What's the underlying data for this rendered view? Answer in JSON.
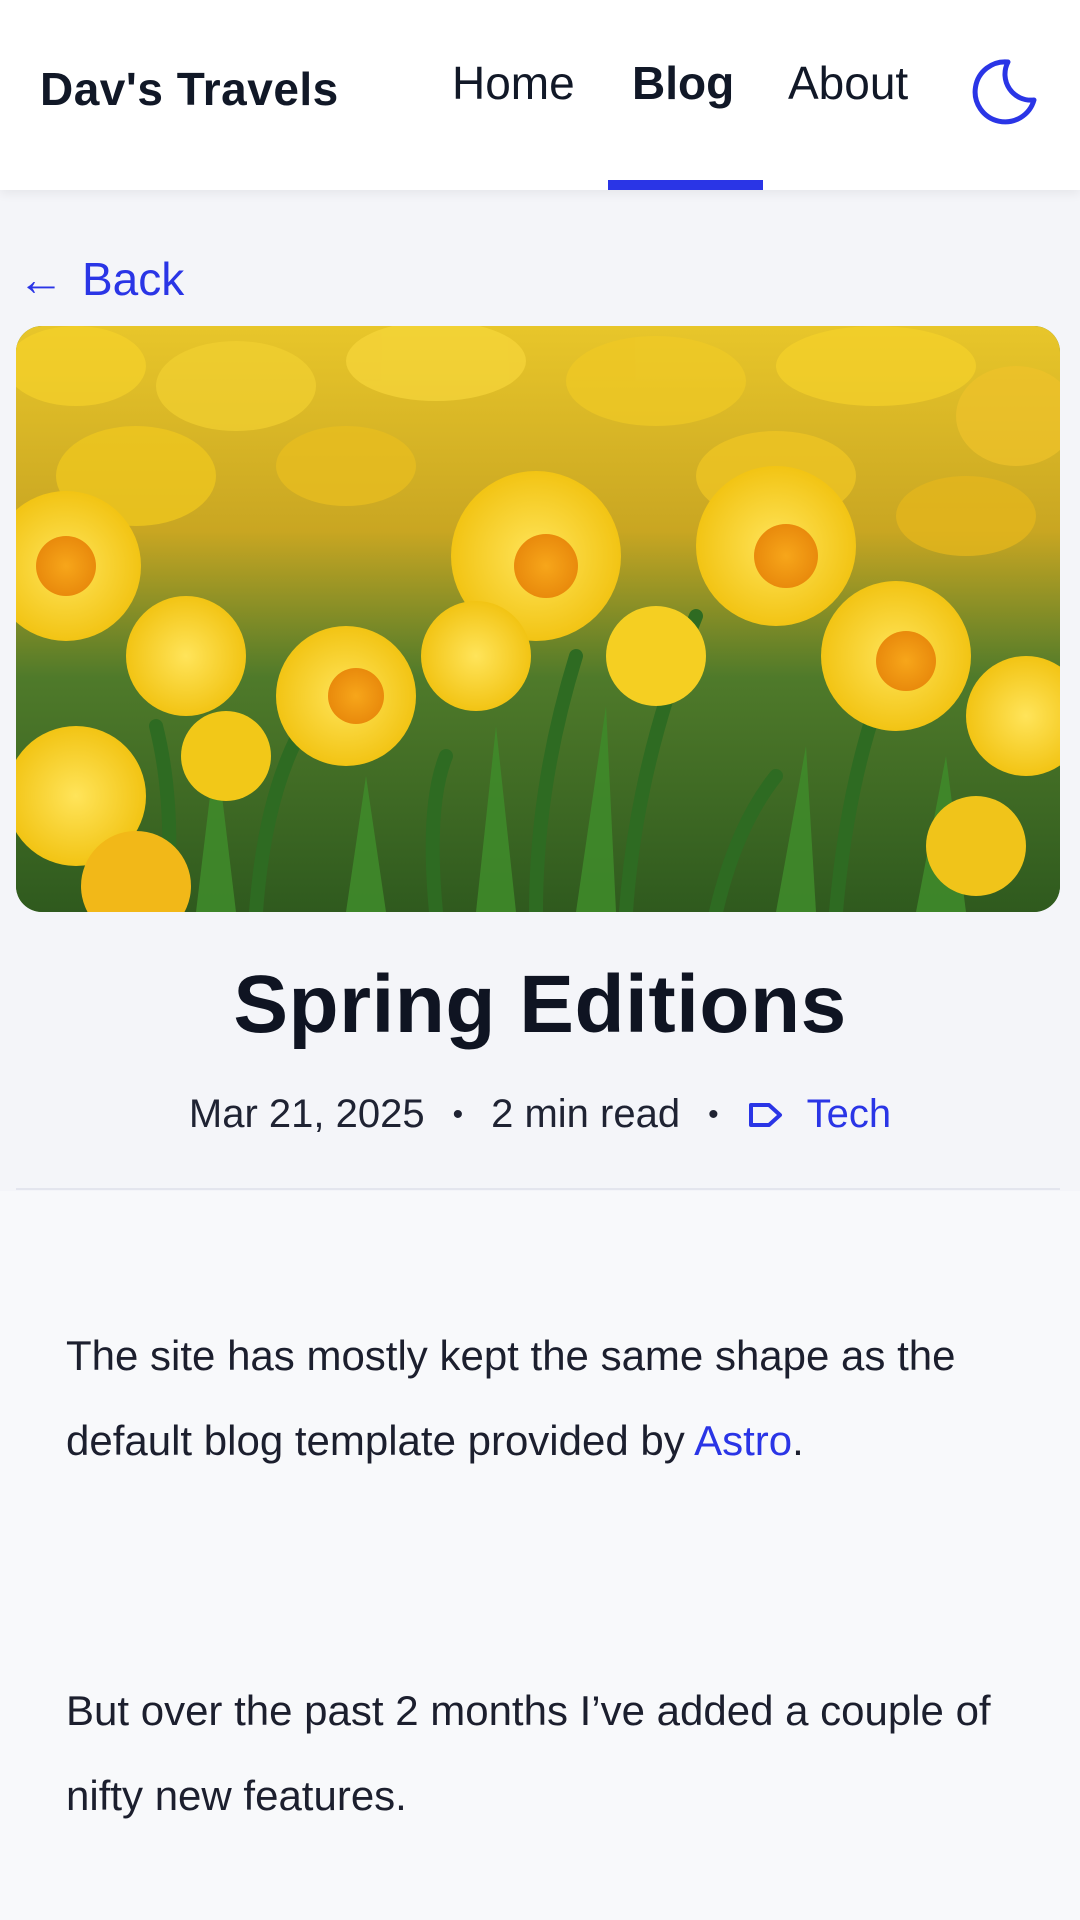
{
  "header": {
    "site_title": "Dav's Travels",
    "nav": [
      {
        "label": "Home"
      },
      {
        "label": "Blog",
        "active": true
      },
      {
        "label": "About"
      }
    ],
    "theme_toggle_icon": "moon-icon",
    "accent_color": "#2a35e6"
  },
  "back": {
    "arrow": "←",
    "label": "Back"
  },
  "hero": {
    "icon": "daffodil-field-photo"
  },
  "post": {
    "title": "Spring Editions",
    "date": "Mar 21, 2025",
    "separator": "•",
    "read_time": "2 min read",
    "tag_icon": "tag-icon",
    "tag": "Tech"
  },
  "body": {
    "p1_before": "The site has mostly kept the same shape as the default blog template provided by ",
    "p1_link": "Astro",
    "p1_after": ".",
    "p2": "But over the past 2 months I’ve added a couple of nifty new features."
  }
}
